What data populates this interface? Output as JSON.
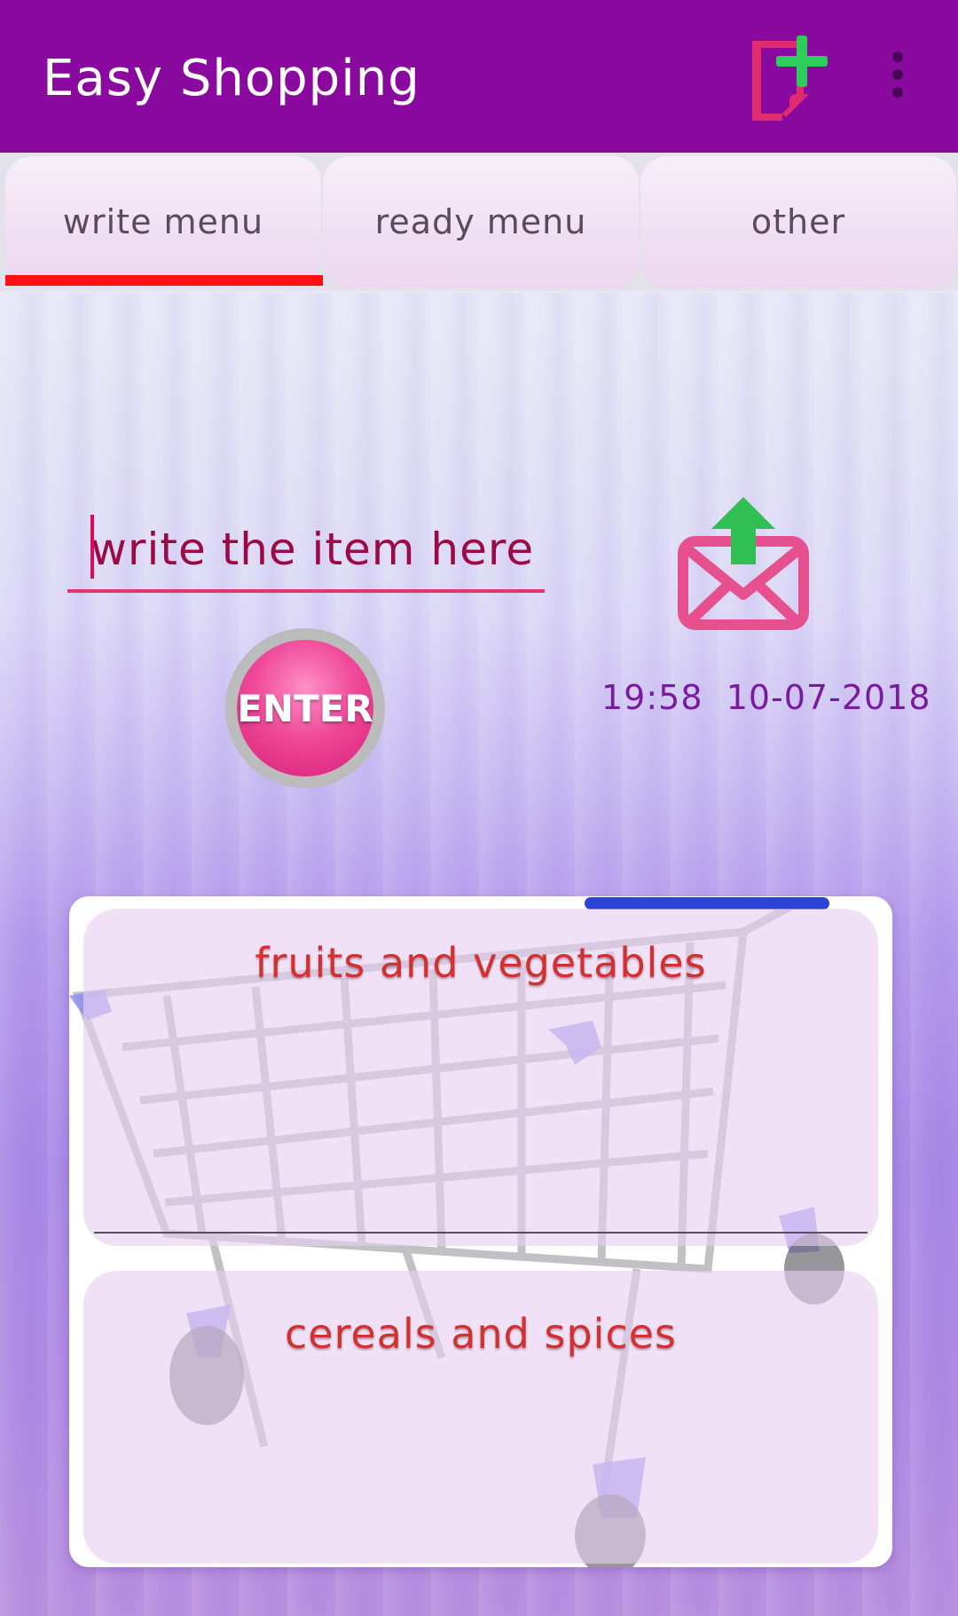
{
  "app": {
    "title": "Easy Shopping"
  },
  "toolbar": {
    "add_icon": "add-list-icon",
    "overflow_icon": "more-vertical-icon"
  },
  "tabs": [
    {
      "label": "write menu",
      "selected": true
    },
    {
      "label": "ready menu",
      "selected": false
    },
    {
      "label": "other",
      "selected": false
    }
  ],
  "item_entry": {
    "placeholder": "write the item here",
    "value": "",
    "enter_label": "ENTER",
    "send_icon": "mail-send-icon"
  },
  "timestamp": {
    "time": "19:58",
    "date": "10-07-2018"
  },
  "categories": [
    {
      "label": "fruits and vegetables"
    },
    {
      "label": "cereals and spices"
    }
  ],
  "colors": {
    "appbar": "#8a0aa0",
    "tab_indicator": "#ff1010",
    "input_underline": "#e0366d",
    "enter_button": "#ef4a9a",
    "category_text": "#d2312f",
    "timestamp_text": "#7a1aa0"
  }
}
